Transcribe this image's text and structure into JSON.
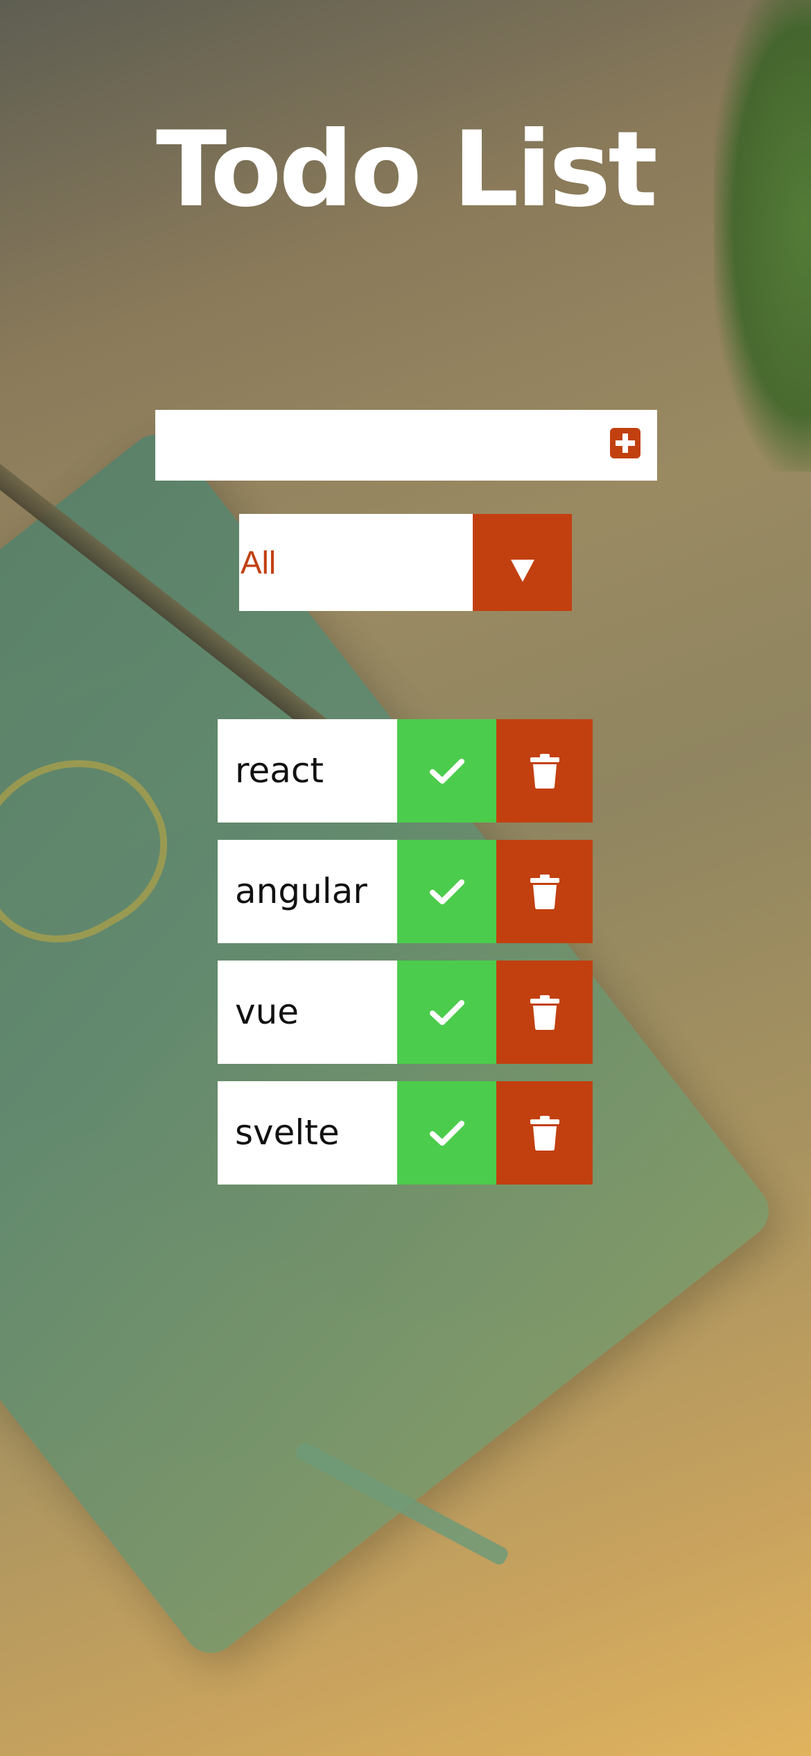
{
  "app": {
    "title": "Todo List"
  },
  "form": {
    "input_value": "",
    "add_icon": "plus-square-icon"
  },
  "filter": {
    "selected": "All",
    "arrow_icon": "caret-down-icon"
  },
  "todos": [
    {
      "text": "react",
      "complete_icon": "check-icon",
      "delete_icon": "trash-icon"
    },
    {
      "text": "angular",
      "complete_icon": "check-icon",
      "delete_icon": "trash-icon"
    },
    {
      "text": "vue",
      "complete_icon": "check-icon",
      "delete_icon": "trash-icon"
    },
    {
      "text": "svelte",
      "complete_icon": "check-icon",
      "delete_icon": "trash-icon"
    }
  ],
  "colors": {
    "accent": "#c24010",
    "complete": "#4ccc4c",
    "surface": "#ffffff"
  }
}
